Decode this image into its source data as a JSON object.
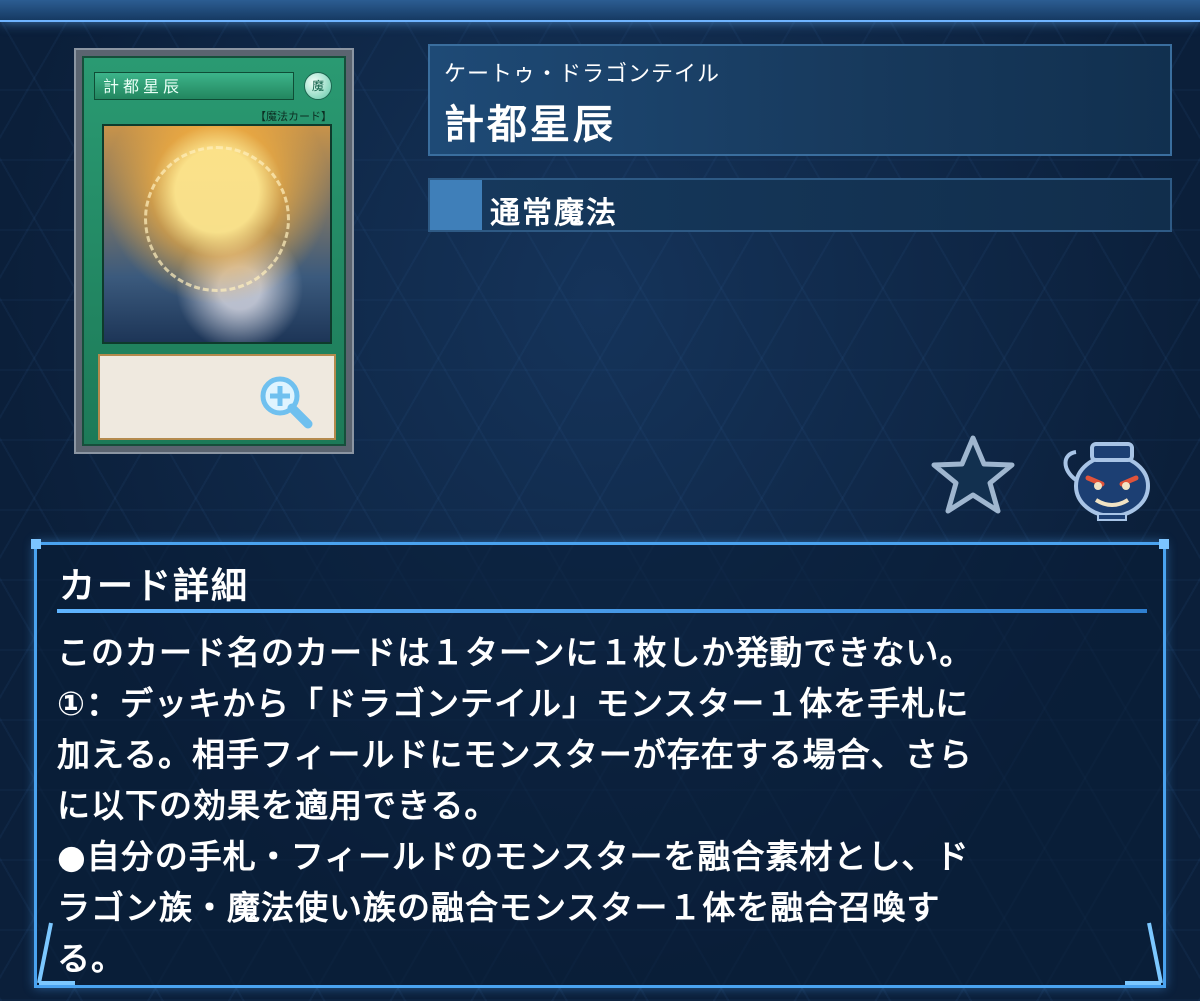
{
  "card": {
    "ruby": "ケートゥ・ドラゴンテイル",
    "name": "計都星辰",
    "type": "通常魔法",
    "thumb_name": "計都星辰",
    "thumb_type_tag": "【魔法カード】",
    "thumb_attr": "魔"
  },
  "details": {
    "title": "カード詳細",
    "text": "このカード名のカードは１ターンに１枚しか発動できない。\n①：デッキから「ドラゴンテイル」モンスター１体を手札に\n加える。相手フィールドにモンスターが存在する場合、さら\nに以下の効果を適用できる。\n●自分の手札・フィールドのモンスターを融合素材とし、ド\nラゴン族・魔法使い族の融合モンスター１体を融合召喚す\nる。"
  },
  "icons": {
    "favorite": "star-icon",
    "related": "pot-icon",
    "zoom": "zoom-in-icon"
  },
  "colors": {
    "background": "#0b1f3a",
    "panel_border": "#4aa3f0",
    "spell_green": "#1d7a58",
    "type_swatch": "#3f7fb9"
  }
}
